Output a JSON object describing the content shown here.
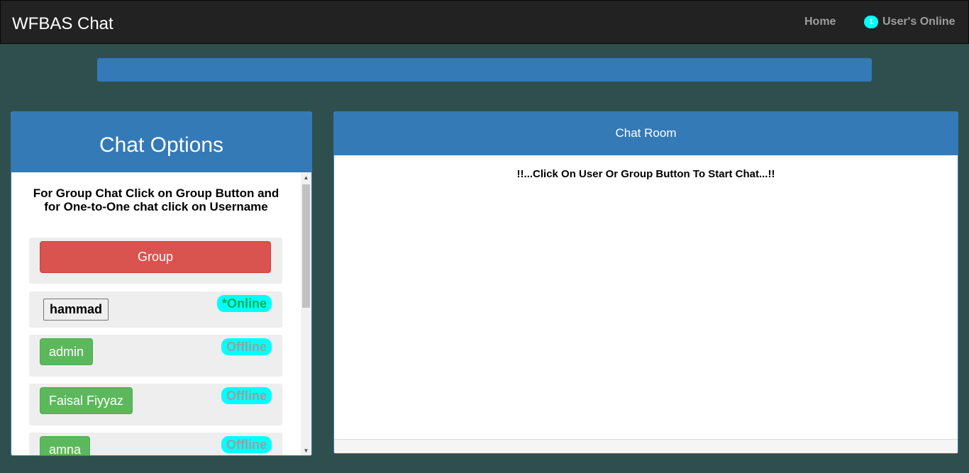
{
  "navbar": {
    "brand": "WFBAS Chat",
    "home_label": "Home",
    "online_count": "1",
    "online_label": "User's Online"
  },
  "options": {
    "title": "Chat Options",
    "instructions": "For Group Chat Click on Group Button and for One-to-One chat click on Username",
    "group_label": "Group",
    "users": [
      {
        "name": "hammad",
        "status": "*Online"
      },
      {
        "name": "admin",
        "status": "Offline"
      },
      {
        "name": "Faisal Fiyyaz",
        "status": "Offline"
      },
      {
        "name": "amna",
        "status": "Offline"
      }
    ]
  },
  "room": {
    "title": "Chat Room",
    "message": "!!...Click On User Or Group Button To Start Chat...!!"
  },
  "colors": {
    "primary": "#337ab7",
    "danger": "#d9534f",
    "success": "#5cb85c",
    "status_pill": "#00ffff",
    "background": "#2f4f4f"
  }
}
